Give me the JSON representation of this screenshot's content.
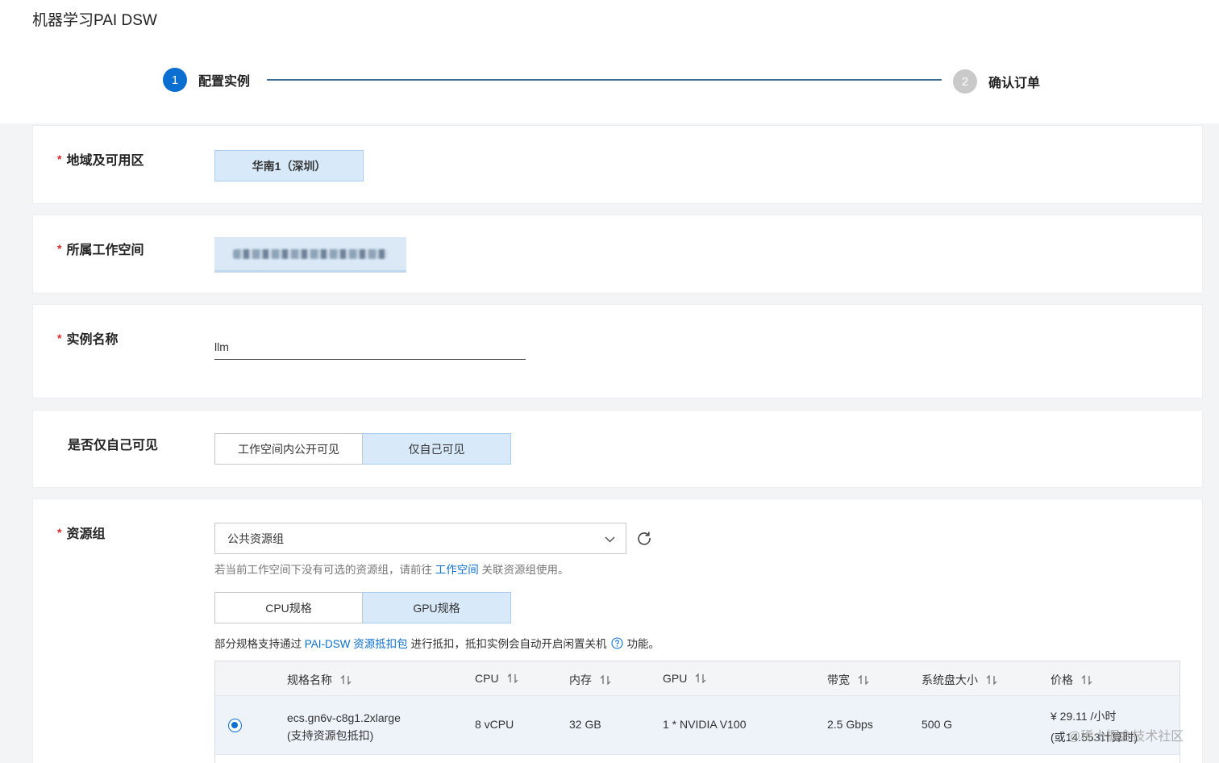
{
  "app": {
    "title": "机器学习PAI DSW"
  },
  "steps": [
    {
      "number": "1",
      "label": "配置实例"
    },
    {
      "number": "2",
      "label": "确认订单"
    }
  ],
  "region": {
    "label": "地域及可用区",
    "value": "华南1（深圳）"
  },
  "workspace": {
    "label": "所属工作空间"
  },
  "instance_name": {
    "label": "实例名称",
    "value": "llm"
  },
  "visibility": {
    "label": "是否仅自己可见",
    "options": [
      "工作空间内公开可见",
      "仅自己可见"
    ],
    "selected": "仅自己可见"
  },
  "resource_group": {
    "label": "资源组",
    "selected": "公共资源组",
    "hint_prefix": "若当前工作空间下没有可选的资源组，请前往",
    "hint_link": "工作空间",
    "hint_suffix": "关联资源组使用。",
    "spec_tabs": [
      "CPU规格",
      "GPU规格"
    ],
    "spec_tab_selected": "GPU规格",
    "info_prefix": "部分规格支持通过",
    "info_link": "PAI-DSW 资源抵扣包",
    "info_middle": "进行抵扣，抵扣实例会自动开启闲置关机",
    "info_suffix": "功能。"
  },
  "spec_table": {
    "columns": [
      "规格名称",
      "CPU",
      "内存",
      "GPU",
      "带宽",
      "系统盘大小",
      "价格"
    ],
    "rows": [
      {
        "name": "ecs.gn6v-c8g1.2xlarge",
        "name_note": "(支持资源包抵扣)",
        "cpu": "8 vCPU",
        "memory": "32 GB",
        "gpu": "1 * NVIDIA V100",
        "bandwidth": "2.5 Gbps",
        "disk": "500 G",
        "price": "¥ 29.11 /小时",
        "price_note": "(或14.553计算时)",
        "selected": true
      }
    ]
  },
  "watermark": "@稀土掘金技术社区"
}
